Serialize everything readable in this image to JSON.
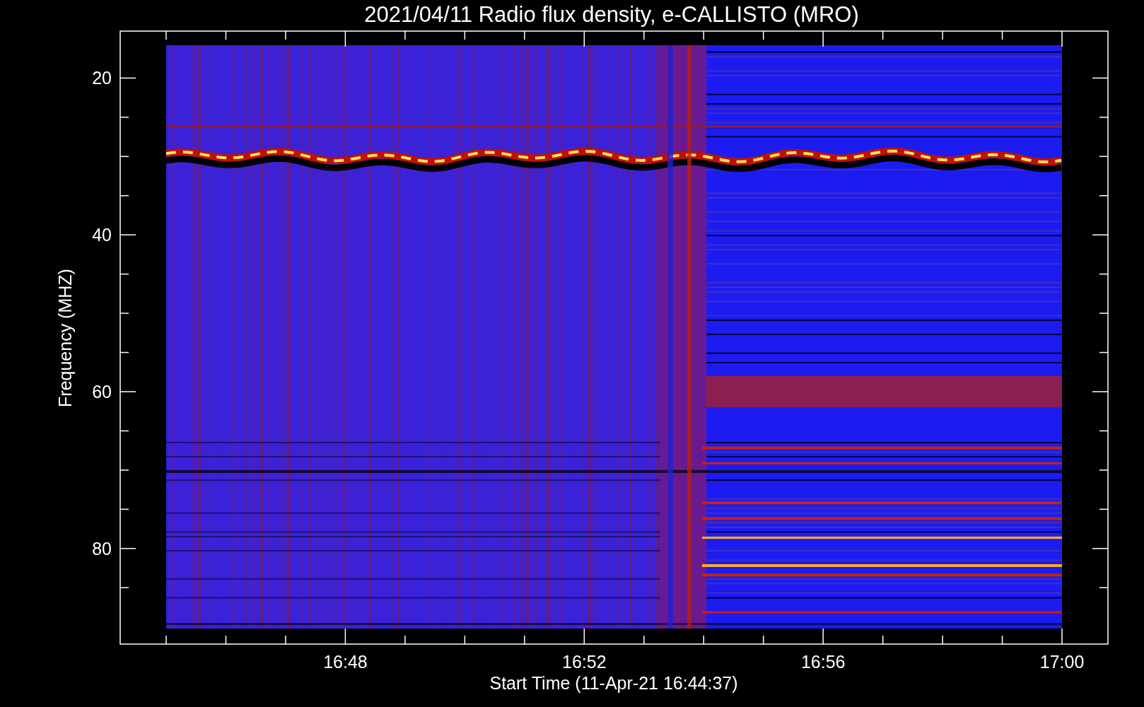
{
  "title": "2021/04/11  Radio flux density, e-CALLISTO (MRO)",
  "xlabel": "Start Time (11-Apr-21 16:44:37)",
  "ylabel": "Frequency (MHZ)",
  "yticks": [
    "20",
    "40",
    "60",
    "80"
  ],
  "xticks": [
    "16:48",
    "16:52",
    "16:56",
    "17:00"
  ]
}
